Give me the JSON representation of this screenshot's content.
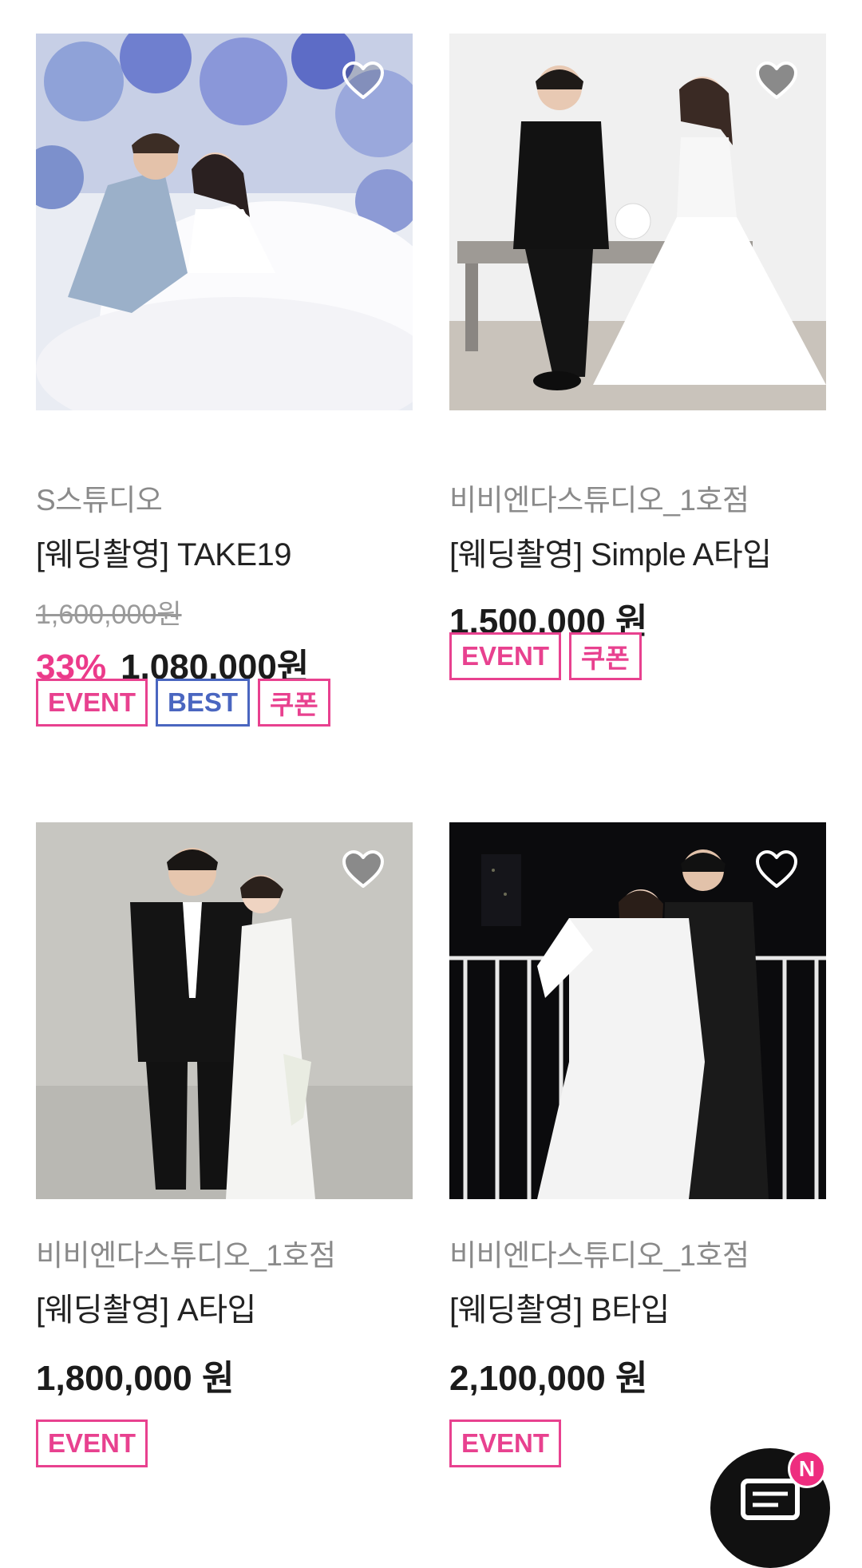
{
  "colors": {
    "event_badge": "#e8418f",
    "best_badge": "#4a66c0",
    "discount": "#ec3a8a",
    "new_badge": "#ee2d7f"
  },
  "products": [
    {
      "studio": "S스튜디오",
      "title": "[웨딩촬영] TAKE19",
      "original_price": "1,600,000원",
      "discount_percent": "33%",
      "sale_price": "1,080,000원",
      "badges": [
        "EVENT",
        "BEST",
        "쿠폰"
      ]
    },
    {
      "studio": "비비엔다스튜디오_1호점",
      "title": "[웨딩촬영] Simple A타입",
      "price": "1,500,000 원",
      "badges": [
        "EVENT",
        "쿠폰"
      ]
    },
    {
      "studio": "비비엔다스튜디오_1호점",
      "title": "[웨딩촬영] A타입",
      "price": "1,800,000 원",
      "badges": [
        "EVENT"
      ]
    },
    {
      "studio": "비비엔다스튜디오_1호점",
      "title": "[웨딩촬영] B타입",
      "price": "2,100,000 원",
      "badges": [
        "EVENT"
      ]
    }
  ],
  "chat_button": {
    "icon": "chat-bubble-icon",
    "new_badge": "N"
  }
}
